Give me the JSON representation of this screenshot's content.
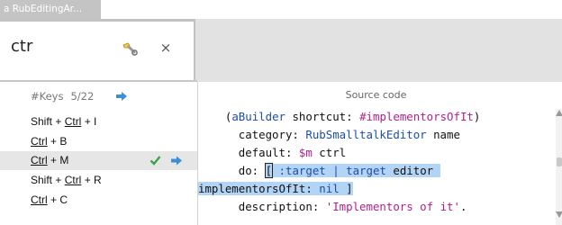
{
  "window": {
    "title": "a RubEditingAr..."
  },
  "search": {
    "value": "ctr"
  },
  "keys_list": {
    "header_label": "#Keys",
    "count": "5/22",
    "items": [
      {
        "parts": [
          {
            "t": "Shift + ",
            "u": false
          },
          {
            "t": "Ctrl",
            "u": true
          },
          {
            "t": " + I",
            "u": false
          }
        ]
      },
      {
        "parts": [
          {
            "t": "Ctrl",
            "u": true
          },
          {
            "t": " + B",
            "u": false
          }
        ]
      },
      {
        "parts": [
          {
            "t": "Ctrl",
            "u": true
          },
          {
            "t": " + M",
            "u": false
          }
        ],
        "selected": true
      },
      {
        "parts": [
          {
            "t": "Shift + ",
            "u": false
          },
          {
            "t": "Ctrl",
            "u": true
          },
          {
            "t": " + R",
            "u": false
          }
        ]
      },
      {
        "parts": [
          {
            "t": "Ctrl",
            "u": true
          },
          {
            "t": " + C",
            "u": false
          }
        ]
      }
    ]
  },
  "source": {
    "title": "Source code",
    "lines": [
      [
        {
          "t": "    (",
          "c": ""
        },
        {
          "t": "aBuilder",
          "c": "kw"
        },
        {
          "t": " shortcut: ",
          "c": ""
        },
        {
          "t": "#implementorsOfIt",
          "c": "mag"
        },
        {
          "t": ")",
          "c": ""
        }
      ],
      [
        {
          "t": "      category: ",
          "c": ""
        },
        {
          "t": "RubSmalltalkEditor",
          "c": "kw"
        },
        {
          "t": " name",
          "c": ""
        }
      ],
      [
        {
          "t": "      default: ",
          "c": ""
        },
        {
          "t": "$m",
          "c": "mag"
        },
        {
          "t": " ctrl",
          "c": ""
        }
      ],
      [
        {
          "t": "      do: ",
          "c": ""
        },
        {
          "t": "[",
          "c": "",
          "box": true,
          "hl": true
        },
        {
          "t": " :target | ",
          "c": "kw",
          "hl": true
        },
        {
          "t": "target",
          "c": "kw",
          "hl": true
        },
        {
          "t": " editor ",
          "c": "",
          "hl": true
        }
      ],
      [
        {
          "t": "implementorsOfIt: ",
          "c": "",
          "hl": true
        },
        {
          "t": "nil",
          "c": "kw",
          "hl": true
        },
        {
          "t": " ]",
          "c": "",
          "hl": true
        }
      ],
      [
        {
          "t": "      description: ",
          "c": ""
        },
        {
          "t": "'Implementors of it'",
          "c": "mag"
        },
        {
          "t": ".",
          "c": ""
        }
      ]
    ]
  },
  "colors": {
    "accent_arrow": "#3a8fd6",
    "check": "#3aa548",
    "selection": "#b3d4f5",
    "keyword": "#1c4ea8",
    "literal": "#b3208a"
  },
  "icons": {
    "tool": "wrench-icon",
    "close": "close-icon",
    "arrow": "arrow-right-icon",
    "check": "checkmark-icon"
  }
}
